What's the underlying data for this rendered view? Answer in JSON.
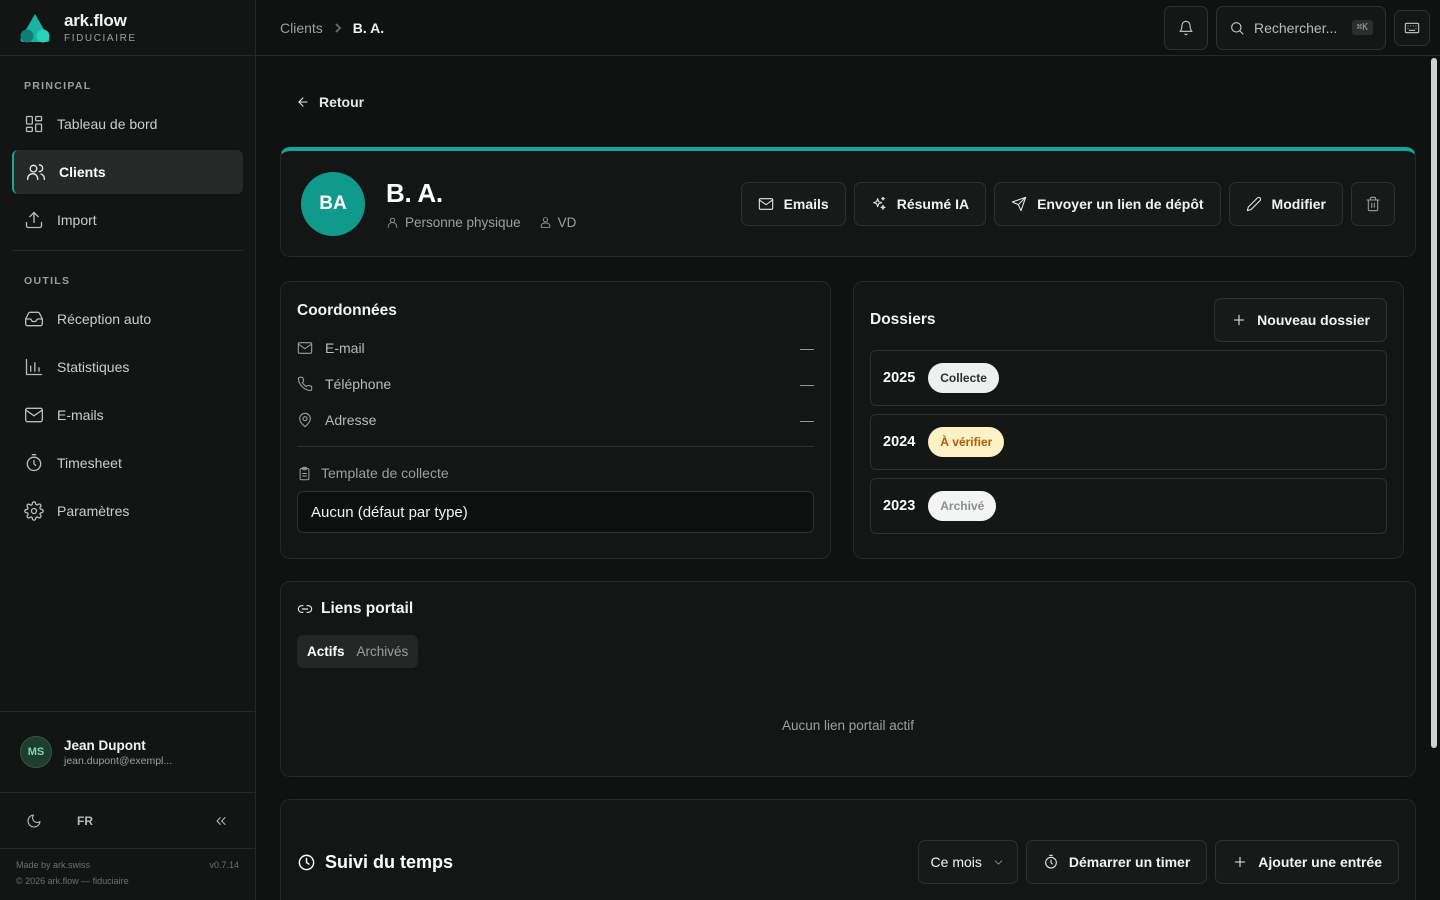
{
  "brand": {
    "name": "ark.flow",
    "subtitle": "FIDUCIAIRE"
  },
  "sidebar": {
    "sections": [
      {
        "title": "PRINCIPAL"
      },
      {
        "title": "OUTILS"
      }
    ],
    "principal_items": [
      {
        "label": "Tableau de bord",
        "icon": "dashboard-icon"
      },
      {
        "label": "Clients",
        "icon": "users-icon",
        "active": true
      },
      {
        "label": "Import",
        "icon": "upload-icon"
      }
    ],
    "tool_items": [
      {
        "label": "Réception auto",
        "icon": "inbox-icon"
      },
      {
        "label": "Statistiques",
        "icon": "bar-chart-icon"
      },
      {
        "label": "E-mails",
        "icon": "mail-icon"
      },
      {
        "label": "Timesheet",
        "icon": "timer-icon"
      },
      {
        "label": "Paramètres",
        "icon": "gear-icon"
      }
    ],
    "user": {
      "initials": "MS",
      "name": "Jean Dupont",
      "email": "jean.dupont@exempl..."
    },
    "language": "FR",
    "footer": {
      "made_by": "Made by  ark.swiss",
      "version": "v0.7.14",
      "copyright": "© 2026 ark.flow — fiduciaire"
    }
  },
  "topbar": {
    "breadcrumb": [
      "Clients",
      "B. A."
    ],
    "search_placeholder": "Rechercher...",
    "search_shortcut": "⌘K"
  },
  "main": {
    "back_label": "Retour",
    "accent_color": "#13a89b",
    "client": {
      "initials": "BA",
      "name": "B. A.",
      "type": "Personne physique",
      "canton": "VD"
    },
    "actions": {
      "emails": "Emails",
      "ai_summary": "Résumé IA",
      "send_link": "Envoyer un lien de dépôt",
      "edit": "Modifier"
    },
    "coordinates": {
      "title": "Coordonnées",
      "fields": [
        {
          "label": "E-mail",
          "value": "—",
          "icon": "mail-icon"
        },
        {
          "label": "Téléphone",
          "value": "—",
          "icon": "phone-icon"
        },
        {
          "label": "Adresse",
          "value": "—",
          "icon": "map-pin-icon"
        }
      ],
      "template_label": "Template de collecte",
      "template_value": "Aucun (défaut par type)"
    },
    "dossiers": {
      "title": "Dossiers",
      "new_button": "Nouveau dossier",
      "items": [
        {
          "year": "2025",
          "status": "Collecte",
          "status_bg": "#eef0ef",
          "status_fg": "#2b2f2d"
        },
        {
          "year": "2024",
          "status": "À vérifier",
          "status_bg": "#fdf1c6",
          "status_fg": "#b35a06"
        },
        {
          "year": "2023",
          "status": "Archivé",
          "status_bg": "#f3f4f3",
          "status_fg": "#8a8f8c"
        }
      ]
    },
    "portal": {
      "title": "Liens portail",
      "tabs": [
        "Actifs",
        "Archivés"
      ],
      "empty_text": "Aucun lien portail actif"
    },
    "time_tracking": {
      "title": "Suivi du temps",
      "period": "Ce mois",
      "start_timer": "Démarrer un timer",
      "add_entry": "Ajouter une entrée"
    }
  }
}
